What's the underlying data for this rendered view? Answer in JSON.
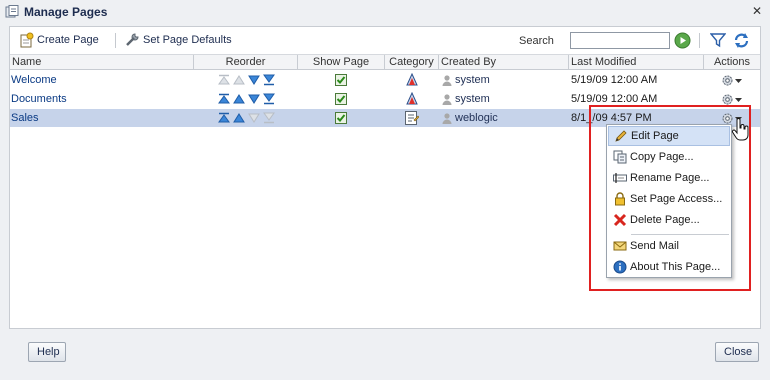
{
  "window": {
    "title": "Manage Pages"
  },
  "toolbar": {
    "create_label": "Create Page",
    "defaults_label": "Set Page Defaults",
    "search_label": "Search",
    "search_value": ""
  },
  "columns": [
    "Name",
    "Reorder",
    "Show Page",
    "Category",
    "Created By",
    "Last Modified",
    "Actions"
  ],
  "rows": [
    {
      "name": "Welcome",
      "show_page": true,
      "category_icon": "cone-icon",
      "created_by": "system",
      "last_modified": "5/19/09 12:00 AM"
    },
    {
      "name": "Documents",
      "show_page": true,
      "category_icon": "cone-icon",
      "created_by": "system",
      "last_modified": "5/19/09 12:00 AM"
    },
    {
      "name": "Sales",
      "show_page": true,
      "category_icon": "document-icon",
      "created_by": "weblogic",
      "last_modified": "8/1_/09 4:57 PM",
      "selected": true
    }
  ],
  "menu": {
    "items": [
      "Edit Page",
      "Copy Page...",
      "Rename Page...",
      "Set Page Access...",
      "Delete Page...",
      "Send Mail",
      "About This Page..."
    ],
    "active_index": 0
  },
  "footer": {
    "help_label": "Help",
    "close_label": "Close"
  },
  "colors": {
    "highlight": "#e02020",
    "selected_row": "#c6d3ea",
    "link": "#0a3a84"
  }
}
